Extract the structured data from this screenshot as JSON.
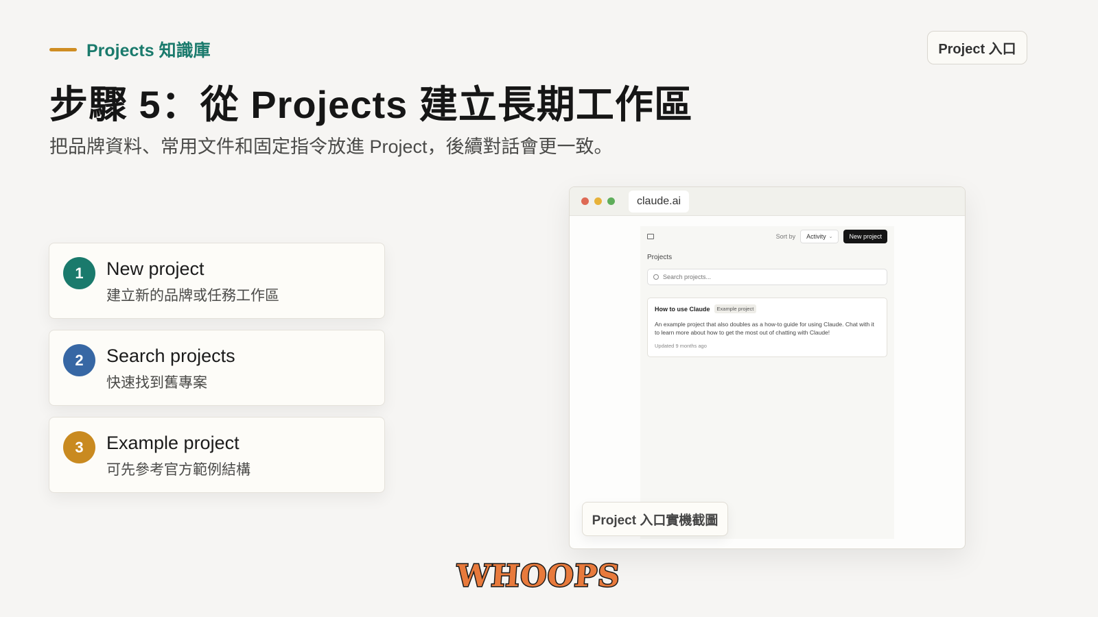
{
  "header": {
    "eyebrow": "Projects 知識庫",
    "corner_tag": "Project 入口",
    "title": "步驟 5：從 Projects 建立長期工作區",
    "subtitle": "把品牌資料、常用文件和固定指令放進 Project，後續對話會更一致。"
  },
  "colors": {
    "accent_teal": "#1a7a6c",
    "accent_blue": "#3767a4",
    "accent_gold": "#c98a20",
    "eyebrow_bar": "#cf8d22"
  },
  "steps": [
    {
      "number": "1",
      "title": "New project",
      "desc": "建立新的品牌或任務工作區"
    },
    {
      "number": "2",
      "title": "Search projects",
      "desc": "快速找到舊專案"
    },
    {
      "number": "3",
      "title": "Example project",
      "desc": "可先參考官方範例結構"
    }
  ],
  "browser": {
    "url": "claude.ai",
    "app": {
      "sort_label": "Sort by",
      "sort_value": "Activity",
      "new_button": "New project",
      "section_label": "Projects",
      "search_placeholder": "Search projects...",
      "card": {
        "name": "How to use Claude",
        "badge": "Example project",
        "desc": "An example project that also doubles as a how-to guide for using Claude. Chat with it to learn more about how to get the most out of chatting with Claude!",
        "meta": "Updated 9 months ago"
      }
    }
  },
  "caption": "Project 入口實機截圖",
  "logo_text": "WHOOPS"
}
